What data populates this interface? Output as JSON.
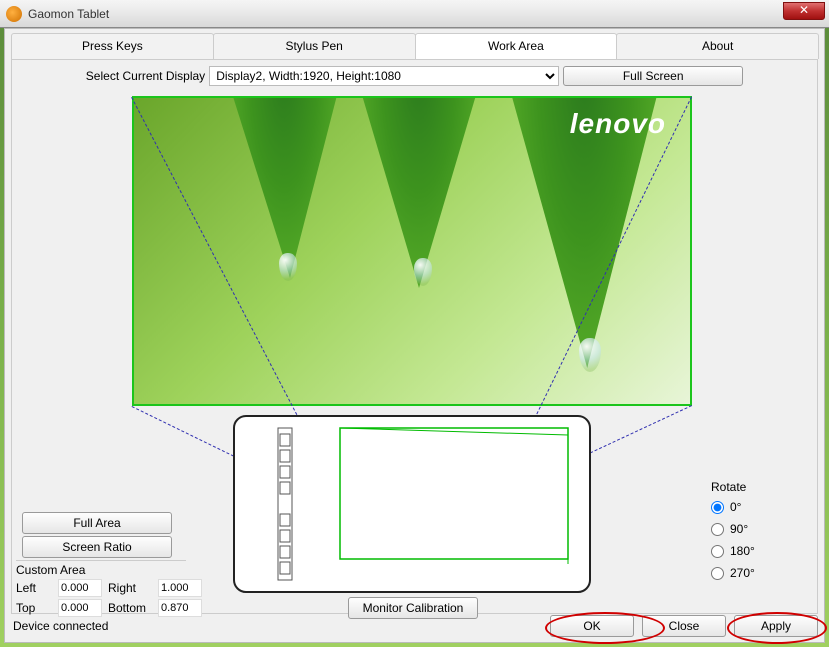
{
  "window": {
    "title": "Gaomon Tablet"
  },
  "tabs": {
    "pressKeys": "Press Keys",
    "stylusPen": "Stylus Pen",
    "workArea": "Work Area",
    "about": "About",
    "active": "workArea"
  },
  "display": {
    "label": "Select Current Display",
    "selected": "Display2, Width:1920, Height:1080",
    "fullScreen": "Full Screen"
  },
  "preview": {
    "brand": "lenovo"
  },
  "areaButtons": {
    "fullArea": "Full Area",
    "screenRatio": "Screen Ratio"
  },
  "customArea": {
    "title": "Custom Area",
    "leftLabel": "Left",
    "left": "0.000",
    "rightLabel": "Right",
    "right": "1.000",
    "topLabel": "Top",
    "top": "0.000",
    "bottomLabel": "Bottom",
    "bottom": "0.870"
  },
  "monitorCalibration": "Monitor Calibration",
  "rotate": {
    "title": "Rotate",
    "options": [
      {
        "label": "0°",
        "value": "0",
        "checked": true
      },
      {
        "label": "90°",
        "value": "90",
        "checked": false
      },
      {
        "label": "180°",
        "value": "180",
        "checked": false
      },
      {
        "label": "270°",
        "value": "270",
        "checked": false
      }
    ]
  },
  "status": "Device connected",
  "bottomButtons": {
    "ok": "OK",
    "close": "Close",
    "apply": "Apply"
  }
}
